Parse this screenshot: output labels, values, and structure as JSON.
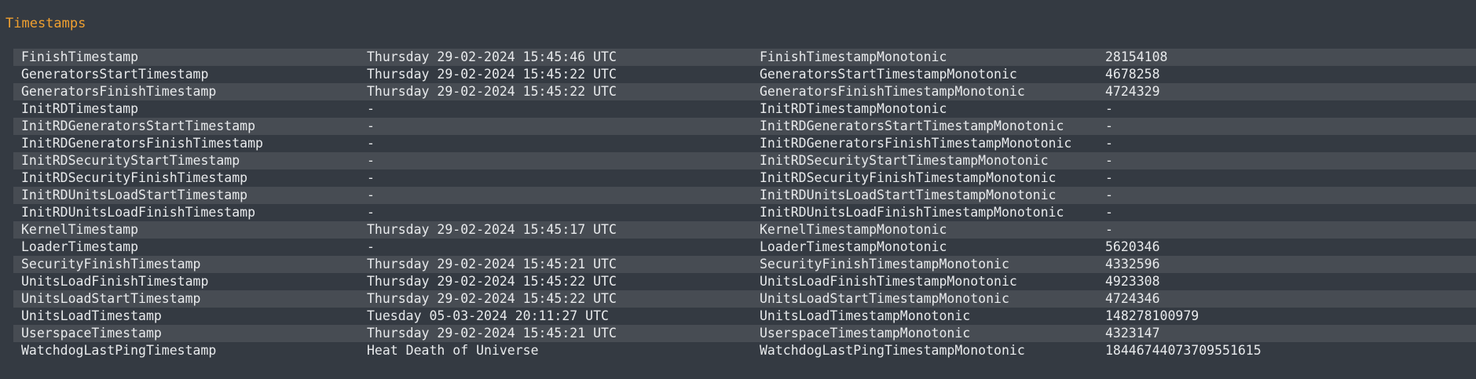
{
  "section": {
    "title": "Timestamps"
  },
  "rows": [
    {
      "name": "FinishTimestamp",
      "value": "Thursday 29-02-2024 15:45:46 UTC",
      "mono_name": "FinishTimestampMonotonic",
      "mono_value": "28154108"
    },
    {
      "name": "GeneratorsStartTimestamp",
      "value": "Thursday 29-02-2024 15:45:22 UTC",
      "mono_name": "GeneratorsStartTimestampMonotonic",
      "mono_value": "4678258"
    },
    {
      "name": "GeneratorsFinishTimestamp",
      "value": "Thursday 29-02-2024 15:45:22 UTC",
      "mono_name": "GeneratorsFinishTimestampMonotonic",
      "mono_value": "4724329"
    },
    {
      "name": "InitRDTimestamp",
      "value": "-",
      "mono_name": "InitRDTimestampMonotonic",
      "mono_value": "-"
    },
    {
      "name": "InitRDGeneratorsStartTimestamp",
      "value": "-",
      "mono_name": "InitRDGeneratorsStartTimestampMonotonic",
      "mono_value": "-"
    },
    {
      "name": "InitRDGeneratorsFinishTimestamp",
      "value": "-",
      "mono_name": "InitRDGeneratorsFinishTimestampMonotonic",
      "mono_value": "-"
    },
    {
      "name": "InitRDSecurityStartTimestamp",
      "value": "-",
      "mono_name": "InitRDSecurityStartTimestampMonotonic",
      "mono_value": "-"
    },
    {
      "name": "InitRDSecurityFinishTimestamp",
      "value": "-",
      "mono_name": "InitRDSecurityFinishTimestampMonotonic",
      "mono_value": "-"
    },
    {
      "name": "InitRDUnitsLoadStartTimestamp",
      "value": "-",
      "mono_name": "InitRDUnitsLoadStartTimestampMonotonic",
      "mono_value": "-"
    },
    {
      "name": "InitRDUnitsLoadFinishTimestamp",
      "value": "-",
      "mono_name": "InitRDUnitsLoadFinishTimestampMonotonic",
      "mono_value": "-"
    },
    {
      "name": "KernelTimestamp",
      "value": "Thursday 29-02-2024 15:45:17 UTC",
      "mono_name": "KernelTimestampMonotonic",
      "mono_value": "-"
    },
    {
      "name": "LoaderTimestamp",
      "value": "-",
      "mono_name": "LoaderTimestampMonotonic",
      "mono_value": "5620346"
    },
    {
      "name": "SecurityFinishTimestamp",
      "value": "Thursday 29-02-2024 15:45:21 UTC",
      "mono_name": "SecurityFinishTimestampMonotonic",
      "mono_value": "4332596"
    },
    {
      "name": "UnitsLoadFinishTimestamp",
      "value": "Thursday 29-02-2024 15:45:22 UTC",
      "mono_name": "UnitsLoadFinishTimestampMonotonic",
      "mono_value": "4923308"
    },
    {
      "name": "UnitsLoadStartTimestamp",
      "value": "Thursday 29-02-2024 15:45:22 UTC",
      "mono_name": "UnitsLoadStartTimestampMonotonic",
      "mono_value": "4724346"
    },
    {
      "name": "UnitsLoadTimestamp",
      "value": "Tuesday 05-03-2024 20:11:27 UTC",
      "mono_name": "UnitsLoadTimestampMonotonic",
      "mono_value": "148278100979"
    },
    {
      "name": "UserspaceTimestamp",
      "value": "Thursday 29-02-2024 15:45:21 UTC",
      "mono_name": "UserspaceTimestampMonotonic",
      "mono_value": "4323147"
    },
    {
      "name": "WatchdogLastPingTimestamp",
      "value": "Heat Death of Universe",
      "mono_name": "WatchdogLastPingTimestampMonotonic",
      "mono_value": "18446744073709551615"
    }
  ],
  "colors": {
    "background": "#343a42",
    "stripe": "#474c53",
    "heading": "#f0a030",
    "text": "#e8eaec"
  }
}
